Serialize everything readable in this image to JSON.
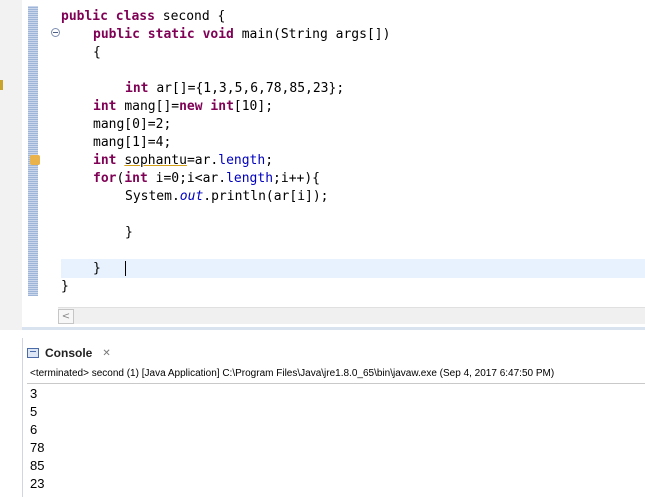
{
  "editor": {
    "lines": [
      {
        "parts": [
          {
            "t": "public class ",
            "c": "kw"
          },
          {
            "t": "second {",
            "c": ""
          }
        ]
      },
      {
        "parts": [
          {
            "t": "public static void ",
            "c": "kw"
          },
          {
            "t": "main(String args[])",
            "c": ""
          }
        ]
      },
      {
        "parts": [
          {
            "t": "{",
            "c": ""
          }
        ]
      },
      {
        "parts": [
          {
            "t": "",
            "c": ""
          }
        ]
      },
      {
        "parts": [
          {
            "t": "int ",
            "c": "kw"
          },
          {
            "t": "ar[]={1,3,5,6,78,85,23};",
            "c": ""
          }
        ]
      },
      {
        "parts": [
          {
            "t": "int ",
            "c": "kw"
          },
          {
            "t": "mang[]=",
            "c": ""
          },
          {
            "t": "new int",
            "c": "kw"
          },
          {
            "t": "[10];",
            "c": ""
          }
        ]
      },
      {
        "parts": [
          {
            "t": "mang[0]=2;",
            "c": ""
          }
        ]
      },
      {
        "parts": [
          {
            "t": "mang[1]=4;",
            "c": ""
          }
        ]
      },
      {
        "parts": [
          {
            "t": "int ",
            "c": "kw"
          },
          {
            "t": "sophantu",
            "c": "underline"
          },
          {
            "t": "=ar.",
            "c": ""
          },
          {
            "t": "length",
            "c": "fld"
          },
          {
            "t": ";",
            "c": ""
          }
        ]
      },
      {
        "parts": [
          {
            "t": "for",
            "c": "kw"
          },
          {
            "t": "(",
            "c": ""
          },
          {
            "t": "int ",
            "c": "kw"
          },
          {
            "t": "i=0;i<ar.",
            "c": ""
          },
          {
            "t": "length",
            "c": "fld"
          },
          {
            "t": ";i++){",
            "c": ""
          }
        ]
      },
      {
        "parts": [
          {
            "t": "System.",
            "c": ""
          },
          {
            "t": "out",
            "c": "static-fld"
          },
          {
            "t": ".println(ar[i]);",
            "c": ""
          }
        ]
      },
      {
        "parts": [
          {
            "t": "",
            "c": ""
          }
        ]
      },
      {
        "parts": [
          {
            "t": "}",
            "c": ""
          }
        ]
      },
      {
        "parts": [
          {
            "t": "",
            "c": ""
          }
        ]
      },
      {
        "parts": [
          {
            "t": "}",
            "c": ""
          }
        ]
      },
      {
        "parts": [
          {
            "t": "}",
            "c": ""
          }
        ]
      }
    ]
  },
  "console": {
    "tab_label": "Console",
    "close_symbol": "✕",
    "status": "<terminated> second (1) [Java Application] C:\\Program Files\\Java\\jre1.8.0_65\\bin\\javaw.exe (Sep 4, 2017 6:47:50 PM)",
    "output": [
      "3",
      "5",
      "6",
      "78",
      "85",
      "23"
    ]
  },
  "scroll": {
    "left_arrow": "<"
  },
  "colors": {
    "keyword": "#7f0055",
    "field": "#0000c0",
    "current_line": "#e8f2fe",
    "ruler": "#9fb5d8"
  }
}
